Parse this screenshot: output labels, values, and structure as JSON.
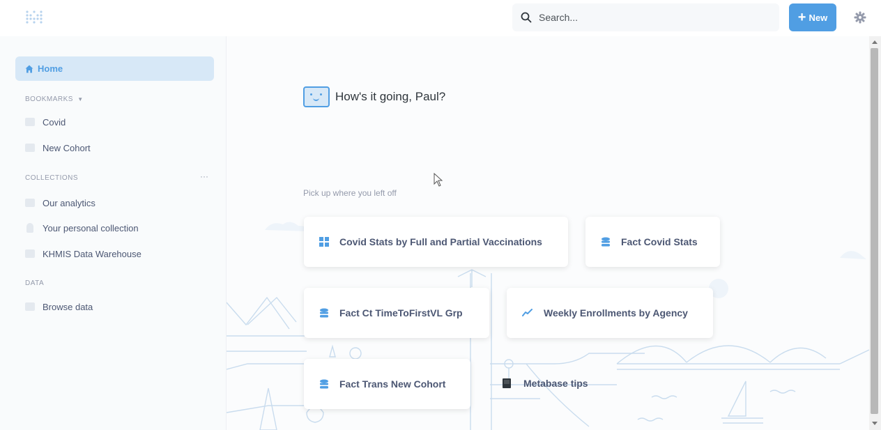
{
  "header": {
    "search_placeholder": "Search...",
    "new_label": "New"
  },
  "sidebar": {
    "home_label": "Home",
    "bookmarks_title": "BOOKMARKS",
    "bookmarks": [
      {
        "label": "Covid"
      },
      {
        "label": "New Cohort"
      }
    ],
    "collections_title": "COLLECTIONS",
    "collections_more": "···",
    "collections": [
      {
        "label": "Our analytics"
      },
      {
        "label": "Your personal collection"
      },
      {
        "label": "KHMIS Data Warehouse"
      }
    ],
    "data_title": "DATA",
    "data_items": [
      {
        "label": "Browse data"
      }
    ]
  },
  "main": {
    "greeting": "How's it going, Paul?",
    "pickup_label": "Pick up where you left off",
    "recents": [
      {
        "label": "Covid Stats by Full and Partial Vaccinations",
        "icon": "table-icon"
      },
      {
        "label": "Fact Covid Stats",
        "icon": "database-icon"
      },
      {
        "label": "Fact Ct TimeToFirstVL Grp",
        "icon": "database-icon"
      },
      {
        "label": "Weekly Enrollments by Agency",
        "icon": "line-chart-icon"
      },
      {
        "label": "Fact Trans New Cohort",
        "icon": "database-icon"
      }
    ],
    "tips_label": "Metabase tips"
  },
  "colors": {
    "brand": "#509ee3",
    "home_bg": "#d7e8f7",
    "text": "#4c5773",
    "muted": "#949aab"
  }
}
